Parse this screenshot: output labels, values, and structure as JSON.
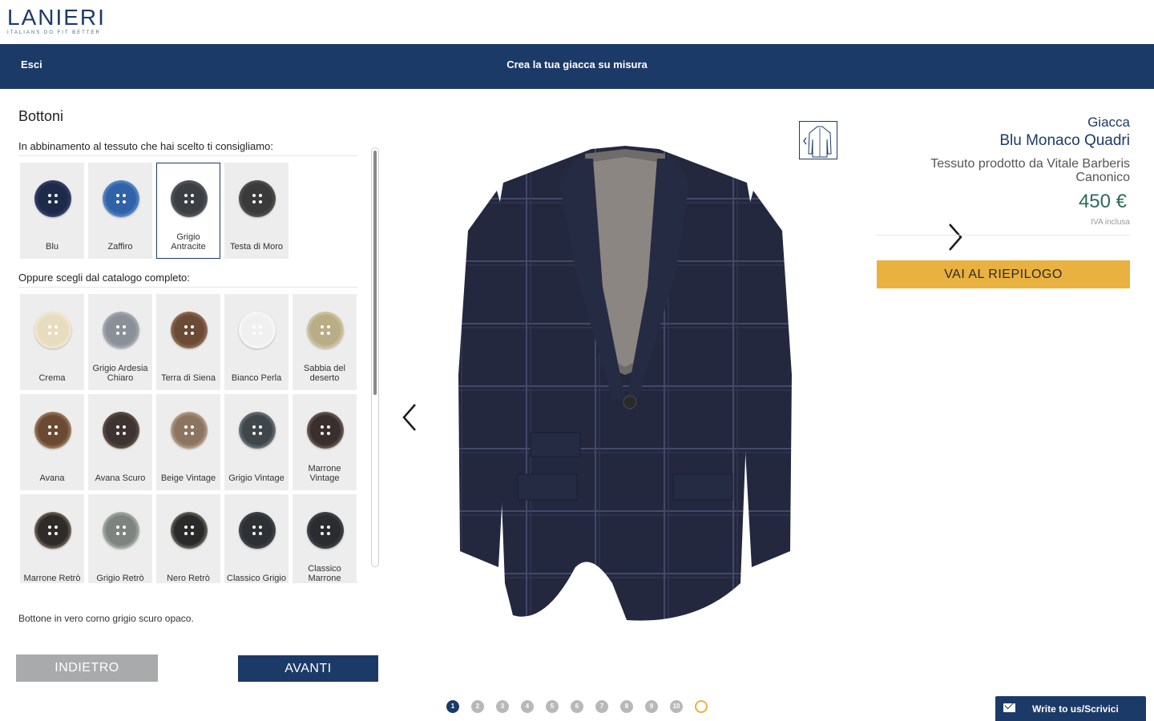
{
  "brand": {
    "name": "LANIERI",
    "tagline": "ITALIANS DO FIT BETTER"
  },
  "topbar": {
    "exit": "Esci",
    "title": "Crea la tua giacca su misura"
  },
  "left": {
    "section_title": "Bottoni",
    "recommended_label": "In abbinamento al tessuto che hai scelto ti consigliamo:",
    "recommended": [
      {
        "name": "Blu",
        "color": "#1e2a4a",
        "ring": "#3b4a77",
        "selected": false
      },
      {
        "name": "Zaffiro",
        "color": "#2f62a6",
        "ring": "#6c98d6",
        "selected": false
      },
      {
        "name": "Grigio Antracite",
        "color": "#3b3e42",
        "ring": "#60646a",
        "selected": true
      },
      {
        "name": "Testa di Moro",
        "color": "#3a3a3a",
        "ring": "#5c5a58",
        "selected": false
      }
    ],
    "catalog_label": "Oppure scegli dal catalogo completo:",
    "catalog": [
      {
        "name": "Crema",
        "color": "#e8dcc0",
        "ring": "#f4ecd8"
      },
      {
        "name": "Grigio Ardesia Chiaro",
        "color": "#8a9098",
        "ring": "#b3b8be"
      },
      {
        "name": "Terra di Siena",
        "color": "#6b4a36",
        "ring": "#a07a62"
      },
      {
        "name": "Bianco Perla",
        "color": "#f0f0f0",
        "ring": "#fafafa"
      },
      {
        "name": "Sabbia del deserto",
        "color": "#b9ad86",
        "ring": "#d7cfae"
      },
      {
        "name": "Avana",
        "color": "#6a4a32",
        "ring": "#b08e6e"
      },
      {
        "name": "Avana Scuro",
        "color": "#3e3330",
        "ring": "#6c5c52"
      },
      {
        "name": "Beige Vintage",
        "color": "#8c7560",
        "ring": "#c2ad98"
      },
      {
        "name": "Grigio Vintage",
        "color": "#3f464c",
        "ring": "#7d868c"
      },
      {
        "name": "Marrone Vintage",
        "color": "#3a2f2c",
        "ring": "#7a6b64"
      },
      {
        "name": "Marrone Retrò",
        "color": "#2f2b28",
        "ring": "#8a7b6a"
      },
      {
        "name": "Grigio Retrò",
        "color": "#7d8480",
        "ring": "#b6bcb8"
      },
      {
        "name": "Nero Retrò",
        "color": "#2a2a2a",
        "ring": "#7c7a74"
      },
      {
        "name": "Classico Grigio",
        "color": "#2d3136",
        "ring": "#4a4f55"
      },
      {
        "name": "Classico Marrone",
        "color": "#2b2c30",
        "ring": "#4b4c50"
      }
    ],
    "description": "Bottone in vero corno grigio scuro opaco.",
    "back_button": "INDIETRO",
    "next_button": "AVANTI"
  },
  "product": {
    "type": "Giacca",
    "name": "Blu Monaco Quadri",
    "fabric": "Tessuto prodotto da Vitale Barberis Canonico",
    "price": "450 €",
    "vat": "IVA inclusa",
    "cta": "VAI AL RIEPILOGO"
  },
  "steps": {
    "labels": [
      "1",
      "2",
      "3",
      "4",
      "5",
      "6",
      "7",
      "8",
      "9",
      "10",
      ""
    ],
    "active_index": 0
  },
  "chat": {
    "label": "Write to us/Scrivici"
  },
  "colors": {
    "navy": "#1c3a67",
    "gold": "#e9b13f",
    "price": "#2d6a58",
    "grey_button": "#a8aaab"
  }
}
